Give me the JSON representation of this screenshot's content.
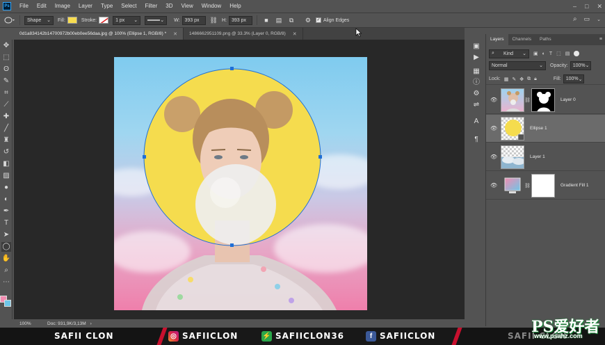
{
  "app": {
    "logo": "Ps"
  },
  "menu": [
    "File",
    "Edit",
    "Image",
    "Layer",
    "Type",
    "Select",
    "Filter",
    "3D",
    "View",
    "Window",
    "Help"
  ],
  "window_controls": {
    "minimize": "–",
    "maximize": "□",
    "close": "✕"
  },
  "options": {
    "mode": "Shape",
    "fill_label": "Fill:",
    "fill_color": "#f7dc4f",
    "stroke_label": "Stroke:",
    "stroke_width": "1 px",
    "w_label": "W:",
    "w_value": "393 px",
    "h_label": "H:",
    "h_value": "393 px",
    "align_edges": "Align Edges",
    "align_edges_checked": true
  },
  "tabs": [
    {
      "label": "0d1a834142b14700972b00eb0ee56daa.jpg @ 100% (Ellipse 1, RGB/8) *",
      "active": true
    },
    {
      "label": "1486662951109.png @ 33.3% (Layer 0, RGB/8)",
      "active": false
    }
  ],
  "status": {
    "zoom": "100%",
    "doc": "Doc: 931,9K/3,13M"
  },
  "tools": [
    "move-icon",
    "marquee-icon",
    "lasso-icon",
    "quick-select-icon",
    "crop-icon",
    "eyedropper-icon",
    "healing-icon",
    "brush-icon",
    "stamp-icon",
    "history-brush-icon",
    "eraser-icon",
    "gradient-icon",
    "blur-icon",
    "dodge-icon",
    "pen-icon",
    "type-icon",
    "path-select-icon",
    "ellipse-tool-icon",
    "hand-icon",
    "zoom-icon",
    "more-icon"
  ],
  "colors": {
    "foreground": "#f28cb1",
    "background": "#6ec6e8",
    "ellipse": "#f5dc4e",
    "selection": "#1f6fd6"
  },
  "layers_panel": {
    "tabs": [
      "Layers",
      "Channels",
      "Paths"
    ],
    "kind": "Kind",
    "blend_mode": "Normal",
    "opacity_label": "Opacity:",
    "opacity_value": "100%",
    "lock_label": "Lock:",
    "fill_label": "Fill:",
    "fill_value": "100%",
    "layers": [
      {
        "name": "Layer 0",
        "selected": false
      },
      {
        "name": "Ellipse 1",
        "selected": true
      },
      {
        "name": "Layer 1",
        "selected": false
      },
      {
        "name": "Gradient Fill 1",
        "selected": false
      }
    ]
  },
  "footer": {
    "name": "SAFII CLON",
    "instagram": "SAFIICLON",
    "handle2": "SAFIICLON36",
    "facebook": "SAFIICLON",
    "tail": "SAFII CLON"
  },
  "watermark": {
    "brand": "PS爱好者",
    "url": "www.psahz.com"
  }
}
